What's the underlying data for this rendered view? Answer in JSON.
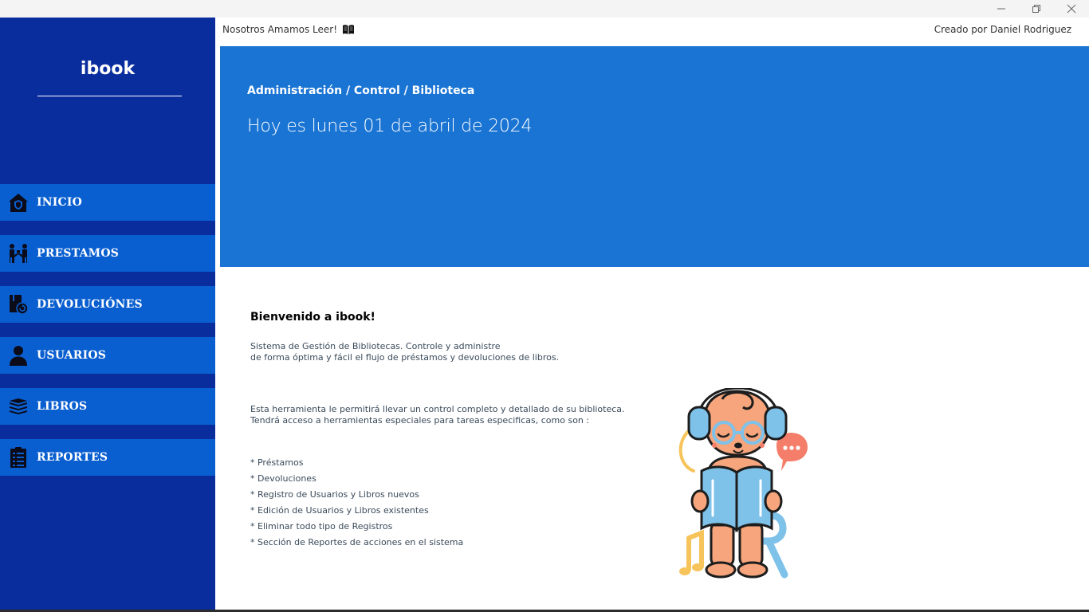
{
  "app": {
    "brand": "ibook",
    "motto": "Nosotros Amamos Leer!",
    "credit": "Creado por Daniel Rodriguez"
  },
  "window_controls": {
    "icons": [
      "minimize-icon",
      "restore-icon",
      "close-icon"
    ]
  },
  "sidebar": {
    "items": [
      {
        "label": "INICIO",
        "icon": "home-icon"
      },
      {
        "label": "PRESTAMOS",
        "icon": "handover-icon"
      },
      {
        "label": "DEVOLUCIÓNES",
        "icon": "return-icon"
      },
      {
        "label": "USUARIOS",
        "icon": "user-icon"
      },
      {
        "label": "LIBROS",
        "icon": "books-icon"
      },
      {
        "label": "REPORTES",
        "icon": "clipboard-icon"
      }
    ]
  },
  "banner": {
    "breadcrumb": "Administración / Control / Biblioteca",
    "date_line": "Hoy es lunes 01 de abril de 2024"
  },
  "welcome": {
    "title": "Bienvenido a ibook!",
    "para1_line1": "Sistema de Gestión de Bibliotecas. Controle y administre",
    "para1_line2": "de forma óptima y fácil el flujo de préstamos y devoluciones de libros.",
    "para2_line1": "Esta herramienta le permitirá llevar un control completo y detallado de su biblioteca.",
    "para2_line2": "Tendrá acceso a herramientas especiales para tareas especificas, como son :",
    "features": [
      "* Préstamos",
      "* Devoluciones",
      "* Registro de Usuarios y Libros nuevos",
      "* Edición de Usuarios y Libros existentes",
      "* Eliminar todo tipo de Registros",
      "* Sección de Reportes de acciones en el sistema"
    ]
  },
  "colors": {
    "sidebar_bg": "#0a2d9e",
    "nav_item_bg": "#0a5fd0",
    "banner_bg": "#1a74d3"
  }
}
